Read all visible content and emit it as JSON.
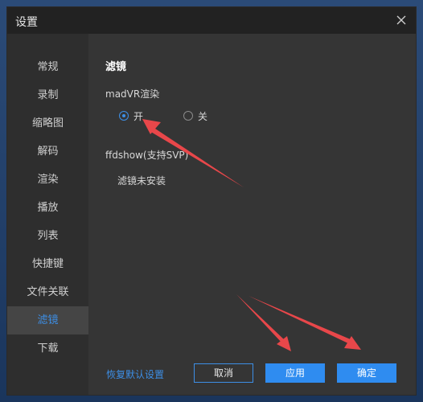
{
  "window": {
    "title": "设置",
    "close_icon": "close-icon"
  },
  "sidebar": {
    "items": [
      {
        "label": "常规"
      },
      {
        "label": "录制"
      },
      {
        "label": "缩略图"
      },
      {
        "label": "解码"
      },
      {
        "label": "渲染"
      },
      {
        "label": "播放"
      },
      {
        "label": "列表"
      },
      {
        "label": "快捷键"
      },
      {
        "label": "文件关联"
      },
      {
        "label": "滤镜",
        "active": true
      },
      {
        "label": "下载"
      }
    ]
  },
  "main": {
    "section_title": "滤镜",
    "madvr": {
      "label": "madVR渲染",
      "options": [
        {
          "label": "开",
          "checked": true
        },
        {
          "label": "关",
          "checked": false
        }
      ]
    },
    "ffdshow": {
      "label": "ffdshow(支持SVP)",
      "status": "滤镜未安装"
    }
  },
  "footer": {
    "reset_link": "恢复默认设置",
    "cancel": "取消",
    "apply": "应用",
    "confirm": "确定"
  },
  "colors": {
    "accent": "#2f8cf0",
    "annotation_arrow": "#e8474a"
  }
}
